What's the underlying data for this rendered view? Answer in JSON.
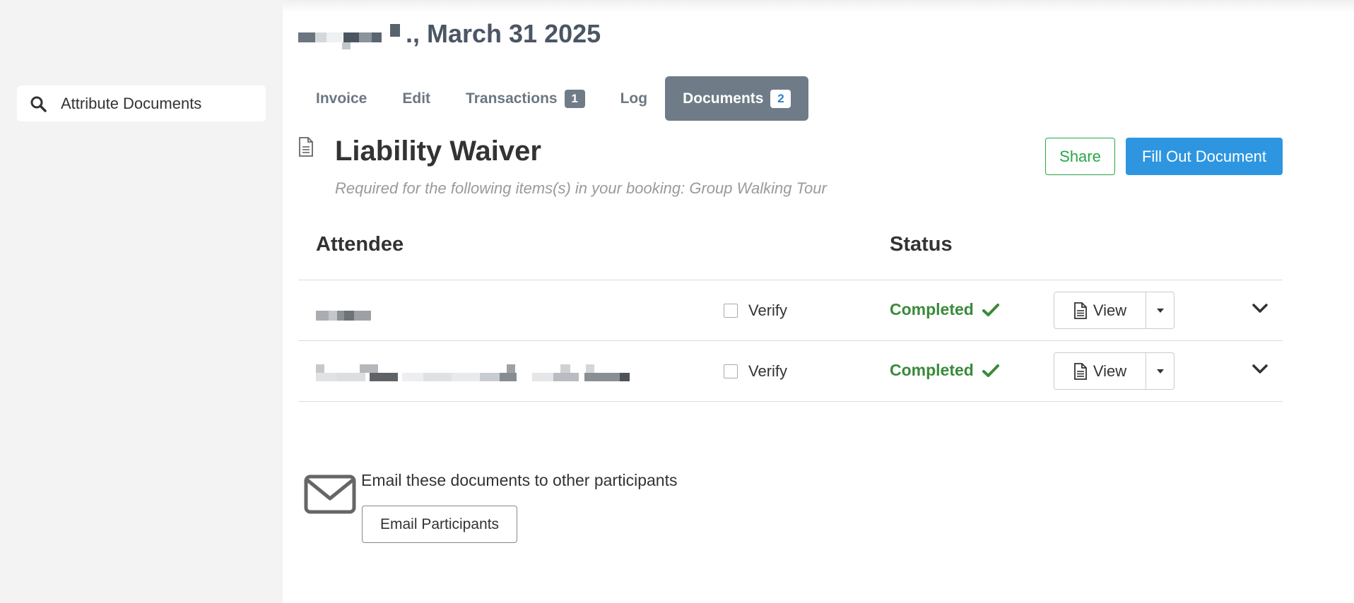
{
  "sidebar": {
    "search_label": "Attribute Documents",
    "search_icon": "search-icon"
  },
  "header": {
    "title_suffix": "., March 31 2025"
  },
  "tabs": [
    {
      "label": "Invoice"
    },
    {
      "label": "Edit"
    },
    {
      "label": "Transactions",
      "badge": "1"
    },
    {
      "label": "Log"
    },
    {
      "label": "Documents",
      "badge": "2",
      "active": true
    }
  ],
  "document": {
    "title": "Liability Waiver",
    "subtitle": "Required for the following items(s) in your booking: Group Walking Tour",
    "share_label": "Share",
    "fill_label": "Fill Out Document"
  },
  "table": {
    "headers": {
      "attendee": "Attendee",
      "status": "Status"
    },
    "rows": [
      {
        "verify_label": "Verify",
        "status": "Completed",
        "view_label": "View"
      },
      {
        "verify_label": "Verify",
        "status": "Completed",
        "view_label": "View"
      }
    ]
  },
  "email": {
    "text": "Email these documents to other participants",
    "button_label": "Email Participants"
  },
  "colors": {
    "active_tab": "#6f7c88",
    "primary": "#2e96e0",
    "success": "#28a745",
    "completed": "#3a8a3a"
  }
}
